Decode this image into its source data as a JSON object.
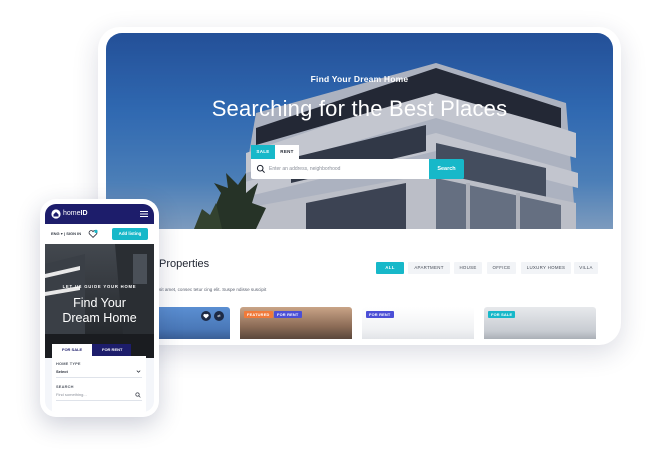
{
  "desktop": {
    "hero": {
      "kicker": "Find Your Dream Home",
      "title": "Searching for the Best Places",
      "tabs": [
        "SALE",
        "RENT"
      ],
      "search_placeholder": "Enter an address, neighborhood",
      "search_button": "Search"
    },
    "section": {
      "title": "Properties",
      "subtitle": "sit amet, consec tetur cing elit. Suspe ndisse suscipit"
    },
    "filters": [
      "ALL",
      "APARTMENT",
      "HOUSE",
      "OFFICE",
      "LUXURY HOMES",
      "VILLA"
    ],
    "cards": [
      {
        "icons": [
          "heart-icon",
          "compare-icon"
        ],
        "compare_glyph": "⇄"
      },
      {
        "badges": [
          "FEATURED",
          "FOR RENT"
        ]
      },
      {
        "badges": [
          "FOR RENT"
        ]
      },
      {
        "badges": [
          "FOR SALE"
        ]
      }
    ]
  },
  "phone": {
    "brand_prefix": "home",
    "brand_suffix": "ID",
    "lang": "ENG",
    "lang_arrow": "▾",
    "sign_in": "SIGN IN",
    "lang_separator": "|",
    "add_listing": "Add listing",
    "hero": {
      "kicker": "LET US GUIDE YOUR HOME",
      "title_line1": "Find Your",
      "title_line2": "Dream Home"
    },
    "tabs": [
      "FOR SALE",
      "FOR RENT"
    ],
    "form": {
      "home_type_label": "HOME TYPE",
      "home_type_value": "Select",
      "search_label": "SEARCH",
      "search_placeholder": "Find something..."
    }
  },
  "colors": {
    "accent": "#17b8c9",
    "navy": "#1d1d6b",
    "featured": "#f07a3a",
    "rent_badge": "#4b4fd6",
    "sale_badge": "#17b8c9"
  }
}
